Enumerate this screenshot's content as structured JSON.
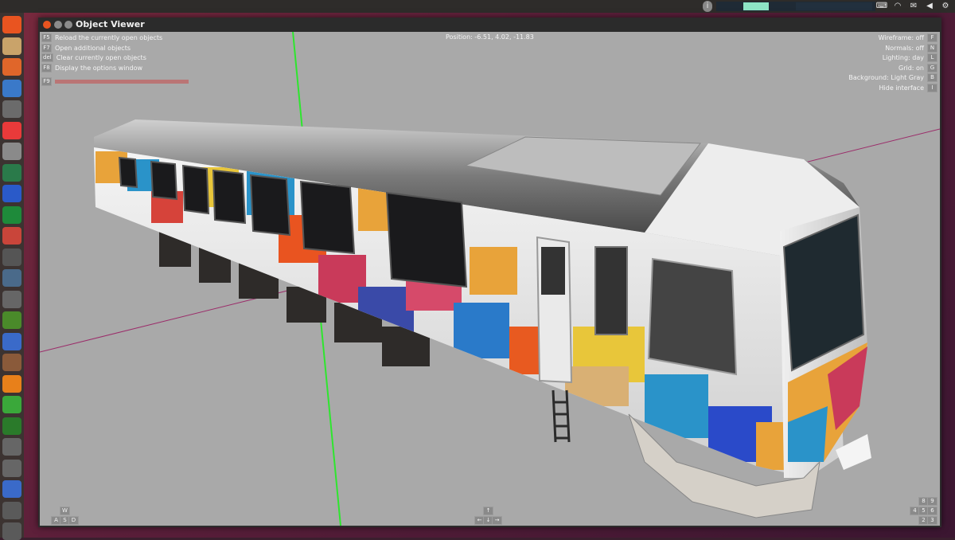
{
  "window": {
    "title": "Object Viewer"
  },
  "position_text": "Position: -6.51, 4.02, -11.83",
  "commands": [
    {
      "key": "F5",
      "label": "Reload the currently open objects"
    },
    {
      "key": "F7",
      "label": "Open additional objects"
    },
    {
      "key": "del",
      "label": "Clear currently open objects"
    },
    {
      "key": "F8",
      "label": "Display the options window"
    }
  ],
  "hint": {
    "key": "F9"
  },
  "status": [
    {
      "label": "Wireframe: off",
      "key": "F"
    },
    {
      "label": "Normals: off",
      "key": "N"
    },
    {
      "label": "Lighting: day",
      "key": "L"
    },
    {
      "label": "Grid: on",
      "key": "G"
    },
    {
      "label": "Background: Light Gray",
      "key": "B"
    },
    {
      "label": "Hide interface",
      "key": "I"
    }
  ],
  "keys_wasd": [
    "W",
    "A",
    "S",
    "D"
  ],
  "keys_arrows": [
    "↑",
    "←",
    "↓",
    "→"
  ],
  "keys_numpad": [
    "8",
    "9",
    "4",
    "5",
    "6",
    "2",
    "3"
  ],
  "launcher_icons": [
    "ubuntu-dash-icon",
    "files-icon",
    "firefox-icon",
    "chromium-icon",
    "speaker-icon",
    "music-icon",
    "camera-icon",
    "globe-icon",
    "network-icon",
    "terminal-icon",
    "image-icon",
    "ts-icon",
    "monitor-icon",
    "b-icon",
    "landscape-icon",
    "cube-icon",
    "audio-icon",
    "blender-icon",
    "green-icon",
    "leaf-icon",
    "b-icon",
    "b-icon",
    "doc-icon",
    "app-icon",
    "app-icon"
  ],
  "colors": {
    "accent_grid_green": "#2ee62e",
    "accent_axis_magenta": "#9b2d6a",
    "viewport_bg": "#a9a9a9"
  }
}
